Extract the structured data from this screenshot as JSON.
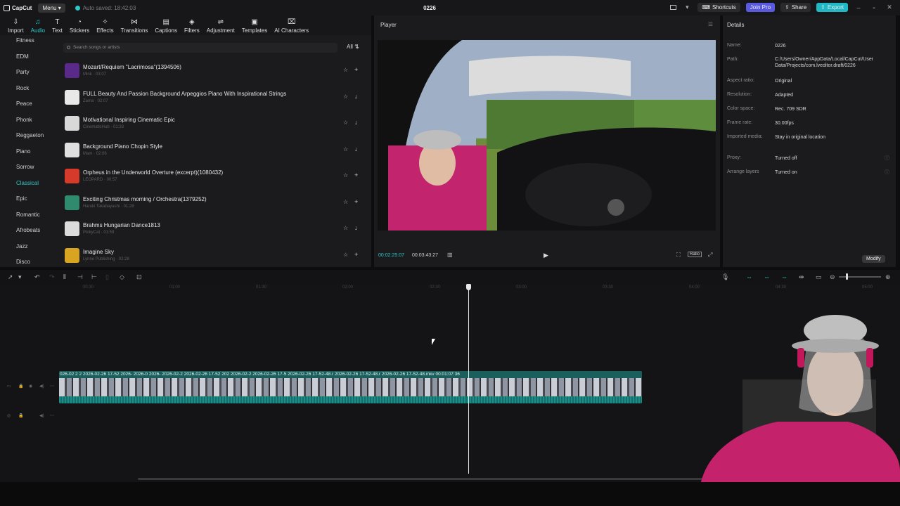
{
  "titlebar": {
    "logo": "CapCut",
    "menu_label": "Menu",
    "autosave": "Auto saved: 18:42:03",
    "project_title": "0226",
    "shortcuts_label": "Shortcuts",
    "join_pro_label": "Join Pro",
    "share_label": "Share",
    "export_label": "Export",
    "icons": [
      "layout-icon",
      "minimize-icon",
      "maximize-icon",
      "close-icon"
    ]
  },
  "toolbar": {
    "tools": [
      {
        "label": "Import",
        "icon": "import-icon"
      },
      {
        "label": "Audio",
        "icon": "audio-icon",
        "active": true
      },
      {
        "label": "Text",
        "icon": "text-icon"
      },
      {
        "label": "Stickers",
        "icon": "sticker-icon"
      },
      {
        "label": "Effects",
        "icon": "effects-icon"
      },
      {
        "label": "Transitions",
        "icon": "transitions-icon"
      },
      {
        "label": "Captions",
        "icon": "captions-icon"
      },
      {
        "label": "Filters",
        "icon": "filters-icon"
      },
      {
        "label": "Adjustment",
        "icon": "adjustment-icon"
      },
      {
        "label": "Templates",
        "icon": "templates-icon"
      },
      {
        "label": "AI Characters",
        "icon": "ai-characters-icon"
      }
    ]
  },
  "categories": [
    "Fitness",
    "EDM",
    "Party",
    "Rock",
    "Peace",
    "Phonk",
    "Reggaeton",
    "Piano",
    "Sorrow",
    "Classical",
    "Epic",
    "Romantic",
    "Afrobeats",
    "Jazz",
    "Disco"
  ],
  "active_category": "Classical",
  "search": {
    "placeholder": "Search songs or artists",
    "filter_label": "All"
  },
  "songs": [
    {
      "title": "Mozart/Requiem \"Lacrimosa\"(1394506)",
      "sub": "Mink · 03:07",
      "color": "#5a2a8a",
      "action": "+"
    },
    {
      "title": "FULL Beauty And Passion Background Arpeggios Piano With Inspirational Strings",
      "sub": "Zama · 02:07",
      "color": "#e8e8e8",
      "action": "↓"
    },
    {
      "title": "Motivational Inspiring Cinematic Epic",
      "sub": "CinematicHub · 01:33",
      "color": "#d8d8d8",
      "action": "↓"
    },
    {
      "title": "Background Piano Chopin Style",
      "sub": "Mam · 02:06",
      "color": "#e0e0e0",
      "action": "↓"
    },
    {
      "title": "Orpheus in the Underworld Overture (excerpt)(1080432)",
      "sub": "LEOPARD · 00:57",
      "color": "#d63a2a",
      "action": "+"
    },
    {
      "title": "Exciting Christmas morning / Orchestra(1379252)",
      "sub": "Haruki Takabayashi · 01:28",
      "color": "#2f8a6e",
      "action": "+"
    },
    {
      "title": "Brahms Hungarian Dance1813",
      "sub": "PinkyCat · 01:59",
      "color": "#dcdcdc",
      "action": "↓"
    },
    {
      "title": "Imagine Sky",
      "sub": "Lynne Publishing · 02:28",
      "color": "#d9a420",
      "action": "+"
    }
  ],
  "player": {
    "title": "Player",
    "time_current": "00:02:25:07",
    "time_total": "00:03:43:27",
    "ratio_label": "Ratio"
  },
  "details": {
    "title": "Details",
    "rows": [
      {
        "label": "Name:",
        "value": "0226"
      },
      {
        "label": "Path:",
        "value": "C:/Users/Owner/AppData/Local/CapCut/User Data/Projects/com.lveditor.draft/0226"
      },
      {
        "label": "Aspect ratio:",
        "value": "Original"
      },
      {
        "label": "Resolution:",
        "value": "Adapted"
      },
      {
        "label": "Color space:",
        "value": "Rec. 709 SDR"
      },
      {
        "label": "Frame rate:",
        "value": "30.00fps"
      },
      {
        "label": "Imported media:",
        "value": "Stay in original location"
      },
      {
        "label": "Proxy:",
        "value": "Turned off"
      },
      {
        "label": "Arrange layers",
        "value": "Turned on"
      }
    ],
    "modify_label": "Modify"
  },
  "timeline": {
    "ruler": [
      "00:30",
      "01:00",
      "01:30",
      "02:00",
      "02:30",
      "03:00",
      "03:30",
      "04:00",
      "04:30",
      "05:00"
    ],
    "clip_label": "026-02  2  2  2026-02-26 17-52  2026-  2026-0  2026-  2026-02-2  2026-02-26 17-52  202  2026-02-2  2026-02-26 17-5  2026-02-26 17-52-48.r  2026-02-26 17-52-48.r  2026-02-26 17-52-48.mkv  00:01:07:36",
    "playhead_fraction": 0.4866
  },
  "colors": {
    "accent": "#2dc8c8",
    "pro": "#5a5ae0",
    "export": "#1fb8c4",
    "clip": "#1f6f6b"
  }
}
